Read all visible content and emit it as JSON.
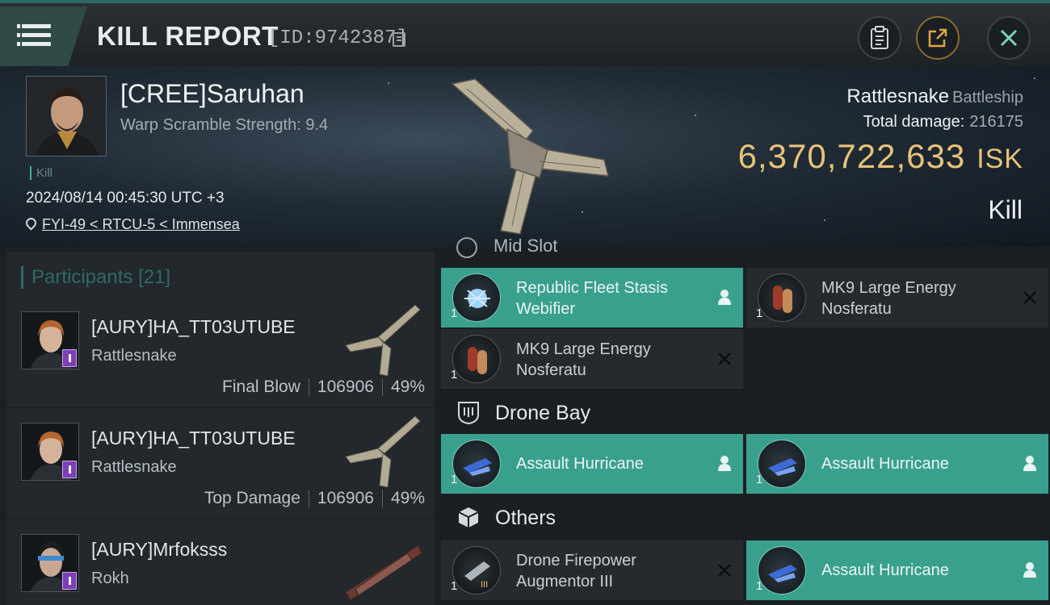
{
  "header": {
    "title": "KILL REPORT",
    "report_id": "[ID:9742387]"
  },
  "victim": {
    "name": "[CREE]Saruhan",
    "warp_scramble": "Warp Scramble Strength: 9.4",
    "kill_tag": "Kill",
    "datetime": "2024/08/14 00:45:30 UTC +3",
    "location": "FYI-49 < RTCU-5 < Immensea",
    "ship": "Rattlesnake",
    "ship_class": "Battleship",
    "total_damage_label": "Total damage:",
    "total_damage": "216175",
    "isk_value": "6,370,722,633",
    "isk_unit": "ISK",
    "result": "Kill"
  },
  "participants": {
    "label": "Participants",
    "count": "[21]",
    "rows": [
      {
        "name": "[AURY]HA_TT03UTUBE",
        "ship": "Rattlesnake",
        "role": "Final Blow",
        "damage": "106906",
        "percent": "49%"
      },
      {
        "name": "[AURY]HA_TT03UTUBE",
        "ship": "Rattlesnake",
        "role": "Top Damage",
        "damage": "106906",
        "percent": "49%"
      },
      {
        "name": "[AURY]Mrfoksss",
        "ship": "Rokh"
      }
    ]
  },
  "modules": {
    "cut_section": "Mid Slot",
    "mid_slot": [
      {
        "name": "Republic Fleet Stasis Webifier",
        "qty": "1",
        "status": "dropped"
      },
      {
        "name": "MK9 Large Energy Nosferatu",
        "qty": "1",
        "status": "destroyed"
      },
      {
        "name": "MK9 Large Energy Nosferatu",
        "qty": "1",
        "status": "destroyed"
      }
    ],
    "drone_bay_title": "Drone Bay",
    "drone_bay": [
      {
        "name": "Assault Hurricane",
        "qty": "1",
        "status": "dropped"
      },
      {
        "name": "Assault Hurricane",
        "qty": "1",
        "status": "dropped"
      }
    ],
    "others_title": "Others",
    "others": [
      {
        "name": "Drone Firepower Augmentor III",
        "qty": "1",
        "status": "destroyed"
      },
      {
        "name": "Assault Hurricane",
        "qty": "1",
        "status": "dropped"
      }
    ]
  },
  "colors": {
    "accent_teal": "#3aa08e",
    "isk_gold": "#e8c27a",
    "badge_purple": "#7c3fb8"
  }
}
